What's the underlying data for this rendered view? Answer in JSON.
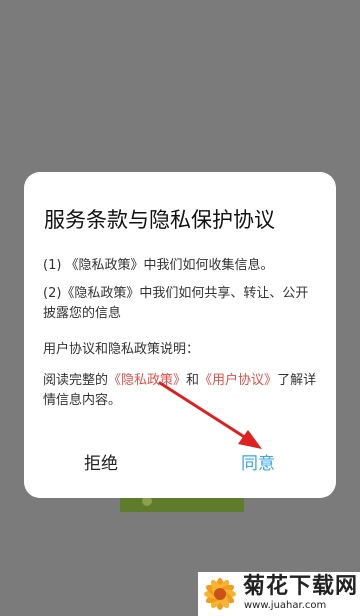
{
  "dialog": {
    "title": "服务条款与隐私保护协议",
    "line1": "(1) 《隐私政策》中我们如何收集信息。",
    "line2": "(2)《隐私政策》中我们如何共享、转让、公开披露您的信息",
    "section_title": "用户协议和隐私政策说明：",
    "read_prefix": "阅读完整的",
    "privacy_link": "《隐私政策》",
    "and_text": "和",
    "user_link": "《用户协议》",
    "read_suffix": "了解详情信息内容。",
    "refuse_label": "拒绝",
    "agree_label": "同意"
  },
  "watermark": {
    "text": "菊花下载网",
    "url": "www.juahar.com"
  },
  "colors": {
    "link": "#e0524c",
    "agree": "#39a6e6",
    "overlay": "#7b7b7b",
    "arrow": "#e02020"
  }
}
